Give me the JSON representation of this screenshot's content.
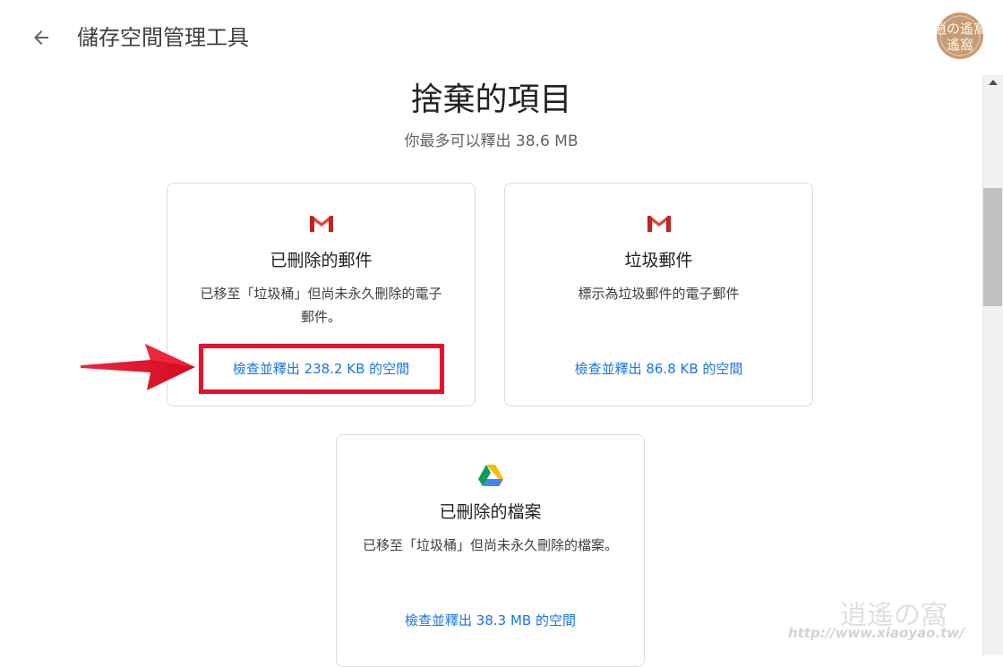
{
  "header": {
    "title": "儲存空間管理工具",
    "back_icon": "arrow-left-icon",
    "avatar_text": "逍の遙窩"
  },
  "section": {
    "title": "捨棄的項目",
    "subtitle": "你最多可以釋出 38.6 MB"
  },
  "cards": [
    {
      "icon": "gmail-icon",
      "title": "已刪除的郵件",
      "description": "已移至「垃圾桶」但尚未永久刪除的電子郵件。",
      "action": "檢查並釋出 238.2 KB 的空間"
    },
    {
      "icon": "gmail-icon",
      "title": "垃圾郵件",
      "description": "標示為垃圾郵件的電子郵件",
      "action": "檢查並釋出 86.8 KB 的空間"
    },
    {
      "icon": "google-drive-icon",
      "title": "已刪除的檔案",
      "description": "已移至「垃圾桶」但尚未永久刪除的檔案。",
      "action": "檢查並釋出 38.3 MB 的空間"
    }
  ],
  "watermark": {
    "logo": "逍遙の窩",
    "url": "http://www.xiaoyao.tw/"
  },
  "colors": {
    "link": "#1a73e8",
    "highlight": "#e8102a",
    "gmail_red": "#ea4335"
  }
}
